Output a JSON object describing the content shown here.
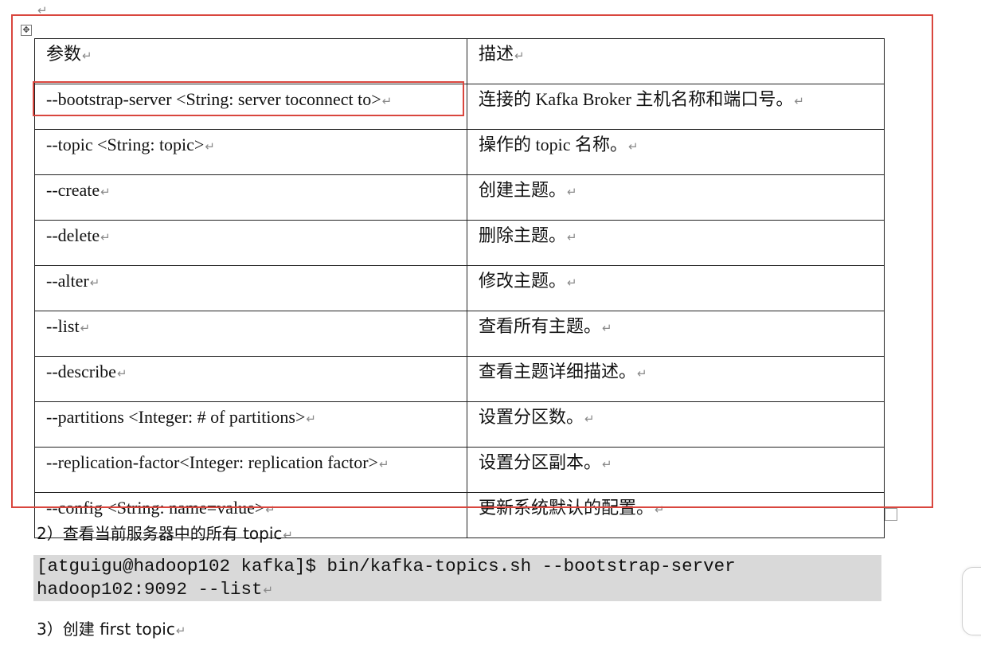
{
  "paragraph_mark": "↵",
  "table": {
    "header": {
      "param": "参数",
      "desc": "描述"
    },
    "rows": [
      {
        "param": "--bootstrap-server <String: server toconnect to>",
        "desc": "连接的 Kafka Broker 主机名称和端口号。"
      },
      {
        "param": "--topic <String: topic>",
        "desc": "操作的 topic 名称。"
      },
      {
        "param": "--create",
        "desc": "创建主题。"
      },
      {
        "param": "--delete",
        "desc": "删除主题。"
      },
      {
        "param": "--alter",
        "desc": "修改主题。"
      },
      {
        "param": "--list",
        "desc": "查看所有主题。"
      },
      {
        "param": "--describe",
        "desc": "查看主题详细描述。"
      },
      {
        "param": "--partitions <Integer: # of partitions>",
        "desc": "设置分区数。"
      },
      {
        "param": "--replication-factor<Integer: replication factor>",
        "desc": "设置分区副本。"
      },
      {
        "param": "--config <String: name=value>",
        "desc": "更新系统默认的配置。"
      }
    ]
  },
  "step2": {
    "label": "2）查看当前服务器中的所有 topic"
  },
  "code": {
    "line1": "[atguigu@hadoop102 kafka]$ bin/kafka-topics.sh --bootstrap-server",
    "line2": "hadoop102:9092 --list"
  },
  "step3": {
    "label": "3）创建 first topic"
  },
  "icons": {
    "move": "table-move-handle-icon",
    "resize": "table-resize-handle-icon",
    "return": "paragraph-mark-icon"
  },
  "colors": {
    "highlight": "#d9463e",
    "code_bg": "#d9d9d9",
    "border": "#222222"
  }
}
